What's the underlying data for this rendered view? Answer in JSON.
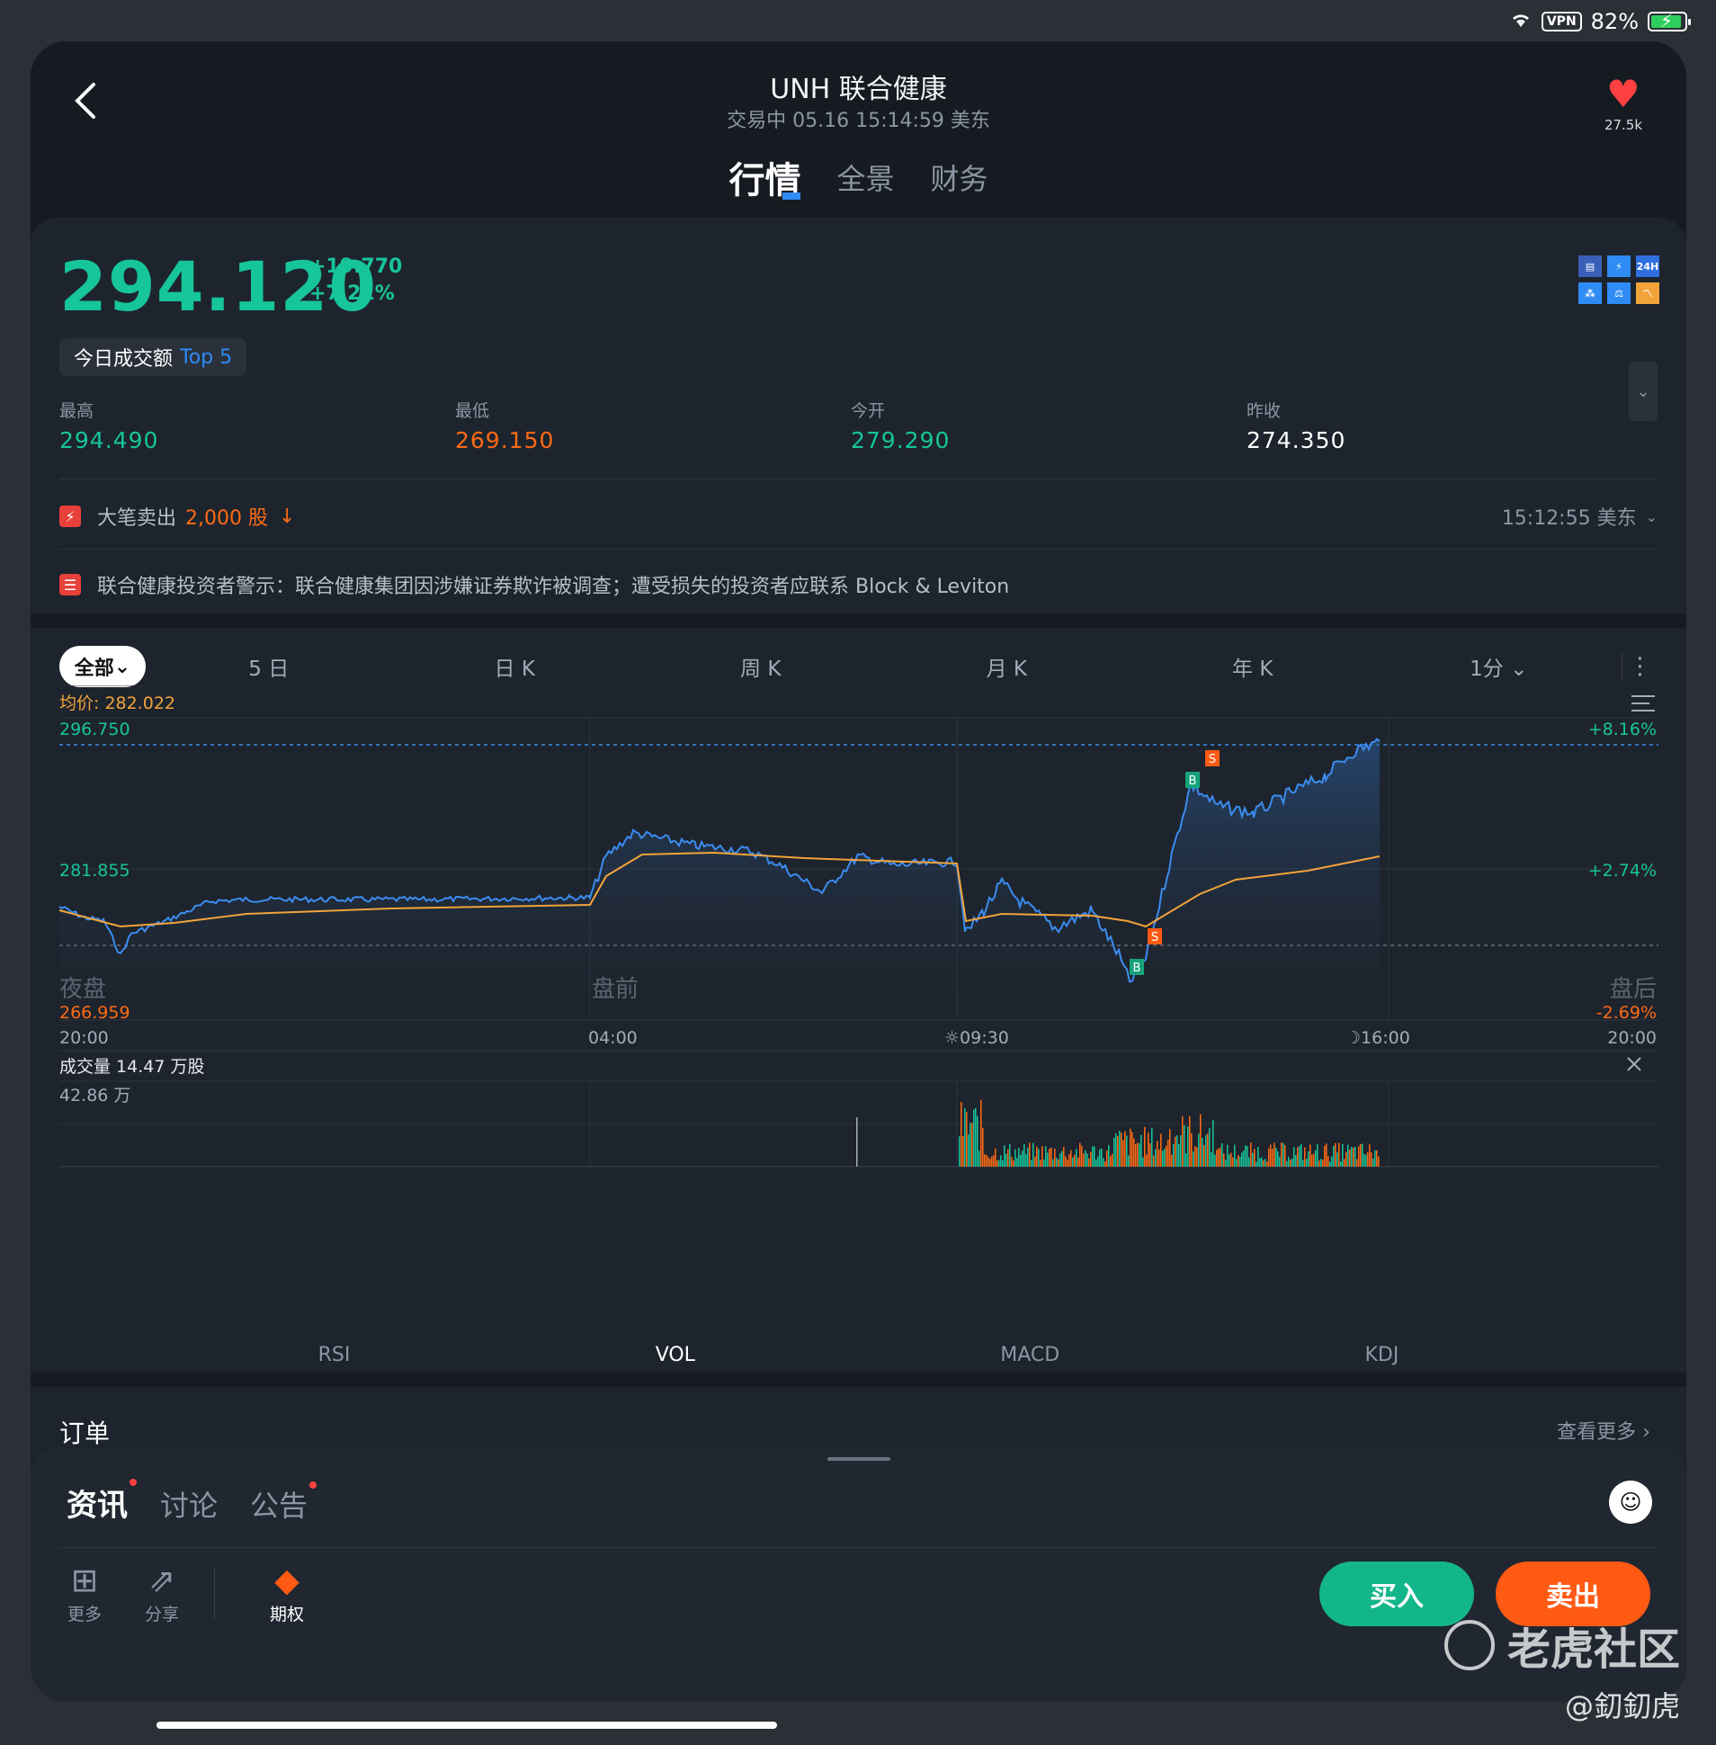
{
  "status": {
    "vpn": "VPN",
    "battery": "82%"
  },
  "header": {
    "title": "UNH 联合健康",
    "subtitle": "交易中 05.16 15:14:59 美东",
    "fav_count": "27.5k",
    "tabs": [
      "行情",
      "全景",
      "财务"
    ]
  },
  "quote": {
    "price": "294.120",
    "change": "+19.770",
    "change_pct": "+7.21%",
    "chip_text": "今日成交额",
    "chip_rank": "Top 5",
    "stats": [
      {
        "label": "最高",
        "value": "294.490",
        "color": "#16c59a"
      },
      {
        "label": "最低",
        "value": "269.150",
        "color": "#ff6a14"
      },
      {
        "label": "今开",
        "value": "279.290",
        "color": "#16c59a"
      },
      {
        "label": "昨收",
        "value": "274.350",
        "color": "#ffffff"
      }
    ],
    "trade_alert_prefix": "大笔卖出",
    "trade_alert_amount": "2,000 股",
    "trade_alert_time": "15:12:55 美东",
    "news_alert": "联合健康投资者警示：联合健康集团因涉嫌证券欺诈被调查；遭受损失的投资者应联系 Block & Leviton"
  },
  "chart": {
    "periods": [
      "全部",
      "5 日",
      "日 K",
      "周 K",
      "月 K",
      "年 K",
      "1分"
    ],
    "avg_label": "均价: 282.022",
    "price_high": "296.750",
    "price_mid": "281.855",
    "price_low": "266.959",
    "pct_high": "+8.16%",
    "pct_mid": "+2.74%",
    "pct_low": "-2.69%",
    "session_labels": [
      "夜盘",
      "盘前",
      "盘后"
    ],
    "time_labels": [
      "20:00",
      "04:00",
      "☼09:30",
      "☽16:00",
      "20:00"
    ],
    "volume_label": "成交量  14.47 万股",
    "volume_max": "42.86 万",
    "indicators": [
      "RSI",
      "VOL",
      "MACD",
      "KDJ"
    ],
    "markers": [
      "B",
      "S",
      "S",
      "B"
    ]
  },
  "orders": {
    "title": "订单",
    "more": "查看更多"
  },
  "news": {
    "tabs": [
      "资讯",
      "讨论",
      "公告"
    ],
    "tools": [
      {
        "label": "更多",
        "icon": "grid-icon"
      },
      {
        "label": "分享",
        "icon": "share-icon"
      },
      {
        "label": "期权",
        "icon": "options-icon"
      }
    ],
    "buy": "买入",
    "sell": "卖出"
  },
  "watermark": {
    "brand": "老虎社区",
    "user": "@釖釖虎"
  },
  "colors": {
    "up": "#16c59a",
    "down": "#ff6a14",
    "line": "#3b8cf0",
    "avg": "#f2a33a"
  }
}
